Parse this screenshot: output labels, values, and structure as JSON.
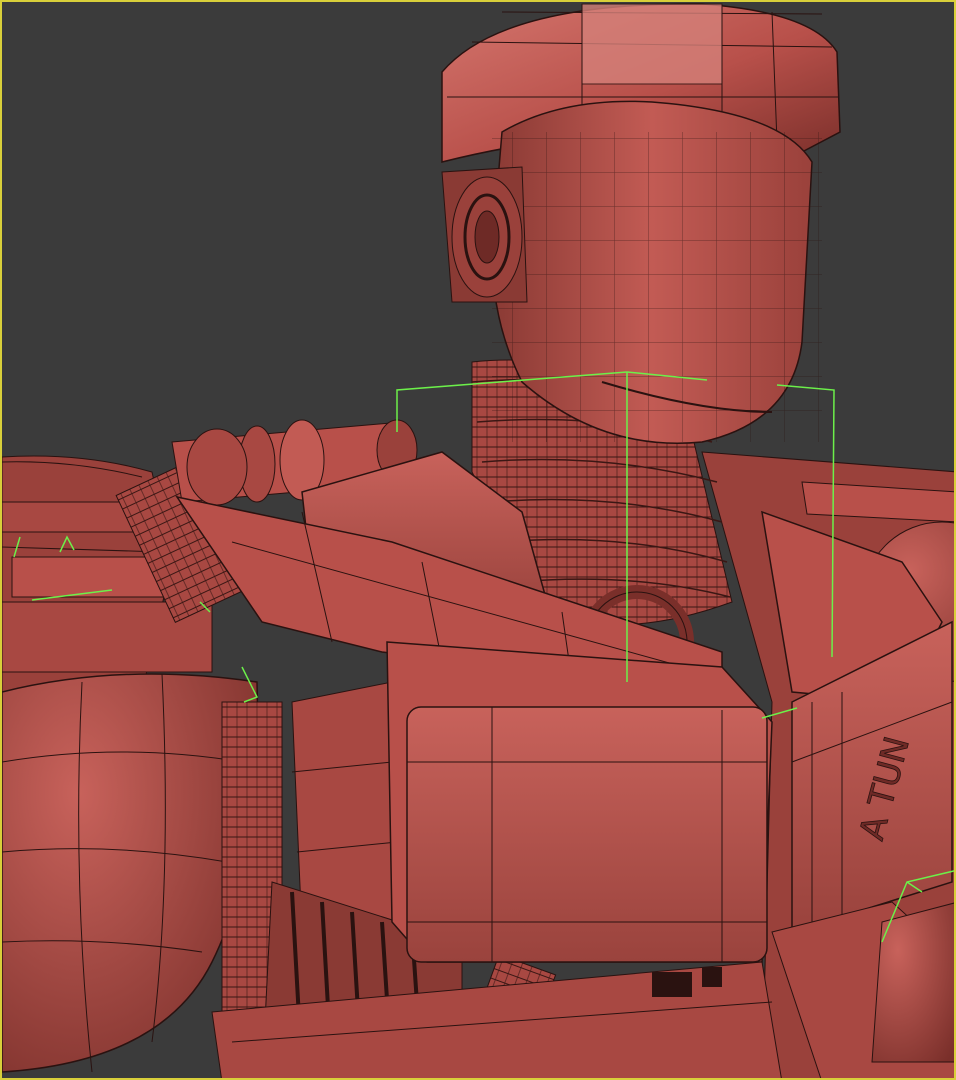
{
  "viewport": {
    "background": "#3b3b3b",
    "frame_color": "#d8cf3a",
    "active": true
  },
  "model": {
    "surface_color": "#b8504a",
    "shadow_color": "#6e2a26",
    "highlight_color": "#d4756d",
    "wireframe_color": "#2a1210",
    "bone_color": "#6cf04a",
    "chest_lettering": "A TUN"
  }
}
